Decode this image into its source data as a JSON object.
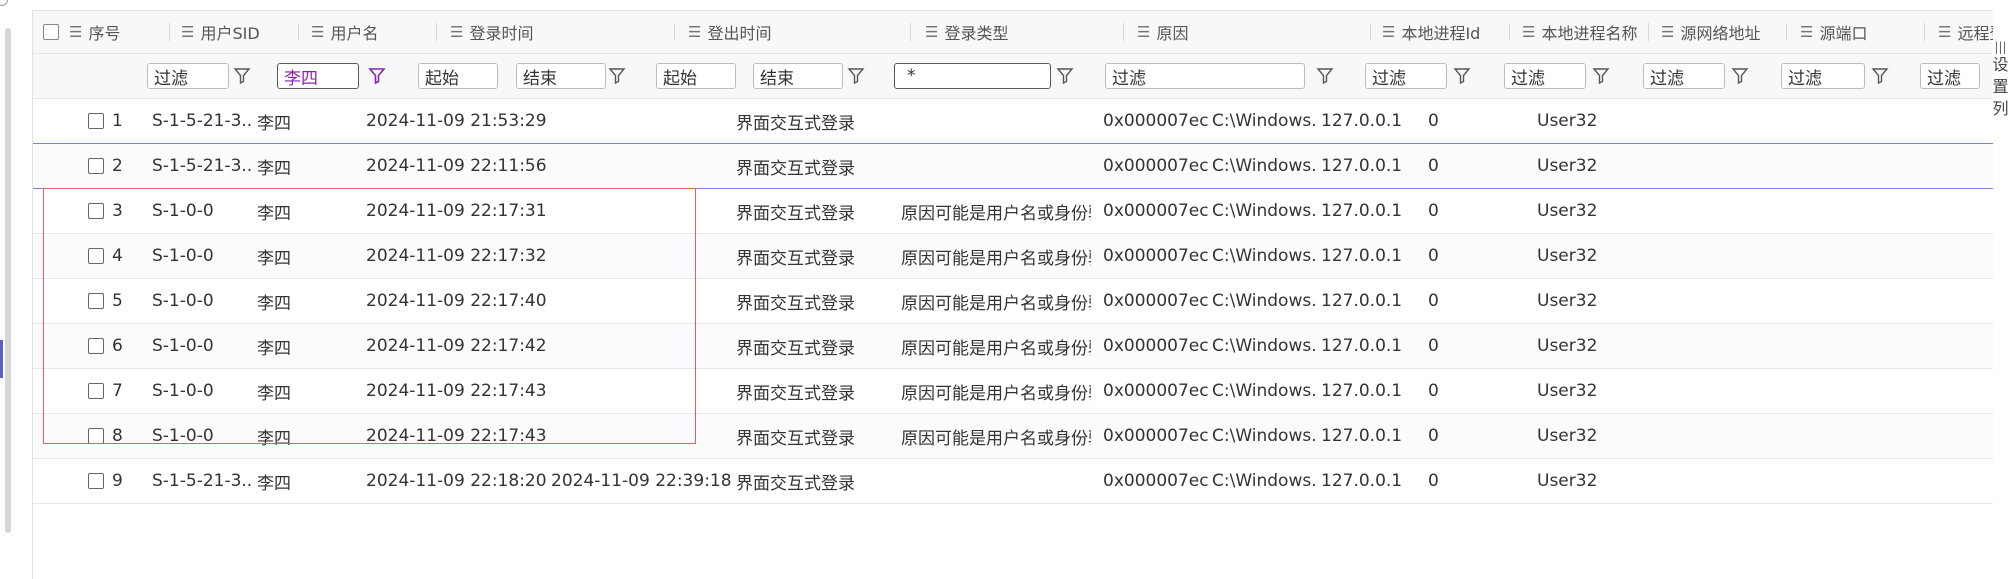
{
  "columns": [
    {
      "key": "seq",
      "label": "序号"
    },
    {
      "key": "sid",
      "label": "用户SID"
    },
    {
      "key": "user",
      "label": "用户名"
    },
    {
      "key": "login",
      "label": "登录时间"
    },
    {
      "key": "logout",
      "label": "登出时间"
    },
    {
      "key": "type",
      "label": "登录类型"
    },
    {
      "key": "reason",
      "label": "原因"
    },
    {
      "key": "pid",
      "label": "本地进程Id"
    },
    {
      "key": "pname",
      "label": "本地进程名称"
    },
    {
      "key": "srcaddr",
      "label": "源网络地址"
    },
    {
      "key": "srcport",
      "label": "源端口"
    },
    {
      "key": "remote",
      "label": "远程登录"
    }
  ],
  "filters": {
    "sid": "过滤",
    "user": "李四",
    "login_start": "起始",
    "login_end": "结束",
    "logout_start": "起始",
    "logout_end": "结束",
    "type": "*",
    "reason": "过滤",
    "pid": "过滤",
    "pname": "过滤",
    "srcaddr": "过滤",
    "srcport": "过滤",
    "remote": "过滤"
  },
  "rows": [
    {
      "seq": "1",
      "sid": "S-1-5-21-3...",
      "user": "李四",
      "login": "2024-11-09 21:53:29",
      "logout": "",
      "type": "界面交互式登录",
      "reason": "",
      "pid": "0x000007ec",
      "pname": "C:\\Windows...",
      "srcaddr": "127.0.0.1",
      "srcport": "0",
      "remote": "User32"
    },
    {
      "seq": "2",
      "sid": "S-1-5-21-3...",
      "user": "李四",
      "login": "2024-11-09 22:11:56",
      "logout": "",
      "type": "界面交互式登录",
      "reason": "",
      "pid": "0x000007ec",
      "pname": "C:\\Windows...",
      "srcaddr": "127.0.0.1",
      "srcport": "0",
      "remote": "User32"
    },
    {
      "seq": "3",
      "sid": "S-1-0-0",
      "user": "李四",
      "login": "2024-11-09 22:17:31",
      "logout": "",
      "type": "界面交互式登录",
      "reason": "原因可能是用户名或身份验...",
      "pid": "0x000007ec",
      "pname": "C:\\Windows...",
      "srcaddr": "127.0.0.1",
      "srcport": "0",
      "remote": "User32"
    },
    {
      "seq": "4",
      "sid": "S-1-0-0",
      "user": "李四",
      "login": "2024-11-09 22:17:32",
      "logout": "",
      "type": "界面交互式登录",
      "reason": "原因可能是用户名或身份验...",
      "pid": "0x000007ec",
      "pname": "C:\\Windows...",
      "srcaddr": "127.0.0.1",
      "srcport": "0",
      "remote": "User32"
    },
    {
      "seq": "5",
      "sid": "S-1-0-0",
      "user": "李四",
      "login": "2024-11-09 22:17:40",
      "logout": "",
      "type": "界面交互式登录",
      "reason": "原因可能是用户名或身份验...",
      "pid": "0x000007ec",
      "pname": "C:\\Windows...",
      "srcaddr": "127.0.0.1",
      "srcport": "0",
      "remote": "User32"
    },
    {
      "seq": "6",
      "sid": "S-1-0-0",
      "user": "李四",
      "login": "2024-11-09 22:17:42",
      "logout": "",
      "type": "界面交互式登录",
      "reason": "原因可能是用户名或身份验...",
      "pid": "0x000007ec",
      "pname": "C:\\Windows...",
      "srcaddr": "127.0.0.1",
      "srcport": "0",
      "remote": "User32"
    },
    {
      "seq": "7",
      "sid": "S-1-0-0",
      "user": "李四",
      "login": "2024-11-09 22:17:43",
      "logout": "",
      "type": "界面交互式登录",
      "reason": "原因可能是用户名或身份验...",
      "pid": "0x000007ec",
      "pname": "C:\\Windows...",
      "srcaddr": "127.0.0.1",
      "srcport": "0",
      "remote": "User32"
    },
    {
      "seq": "8",
      "sid": "S-1-0-0",
      "user": "李四",
      "login": "2024-11-09 22:17:43",
      "logout": "",
      "type": "界面交互式登录",
      "reason": "原因可能是用户名或身份验...",
      "pid": "0x000007ec",
      "pname": "C:\\Windows...",
      "srcaddr": "127.0.0.1",
      "srcport": "0",
      "remote": "User32"
    },
    {
      "seq": "9",
      "sid": "S-1-5-21-3...",
      "user": "李四",
      "login": "2024-11-09 22:18:20",
      "logout": "2024-11-09 22:39:18",
      "type": "界面交互式登录",
      "reason": "",
      "pid": "0x000007ec",
      "pname": "C:\\Windows...",
      "srcaddr": "127.0.0.1",
      "srcport": "0",
      "remote": "User32"
    }
  ],
  "settings_label": "设置列",
  "colors": {
    "active_filter": "#8a23b0",
    "selection_box": "#e06060",
    "row_divider_blue": "#7b7be0"
  }
}
